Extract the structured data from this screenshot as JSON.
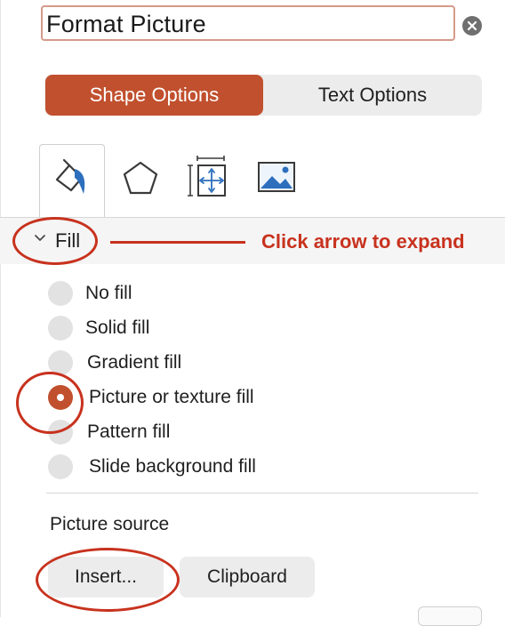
{
  "panel": {
    "title": "Format Picture"
  },
  "options_tabs": {
    "shape_options": "Shape Options",
    "text_options": "Text Options",
    "active": "shape_options"
  },
  "icon_tabs": [
    {
      "name": "fill-line-icon",
      "active": true
    },
    {
      "name": "effects-pentagon-icon",
      "active": false
    },
    {
      "name": "size-properties-icon",
      "active": false
    },
    {
      "name": "picture-icon",
      "active": false
    }
  ],
  "fill_section": {
    "label": "Fill",
    "expanded": true,
    "hint": "Click arrow to expand",
    "options": [
      {
        "label": "No fill",
        "checked": false
      },
      {
        "label": "Solid fill",
        "checked": false
      },
      {
        "label": "Gradient fill",
        "checked": false
      },
      {
        "label": "Picture or texture fill",
        "checked": true
      },
      {
        "label": "Pattern fill",
        "checked": false
      },
      {
        "label": "Slide background fill",
        "checked": false
      }
    ]
  },
  "picture_source": {
    "label": "Picture source",
    "insert_button": "Insert...",
    "clipboard_button": "Clipboard"
  },
  "colors": {
    "accent": "#c1502e",
    "annotation": "#c8321e"
  }
}
